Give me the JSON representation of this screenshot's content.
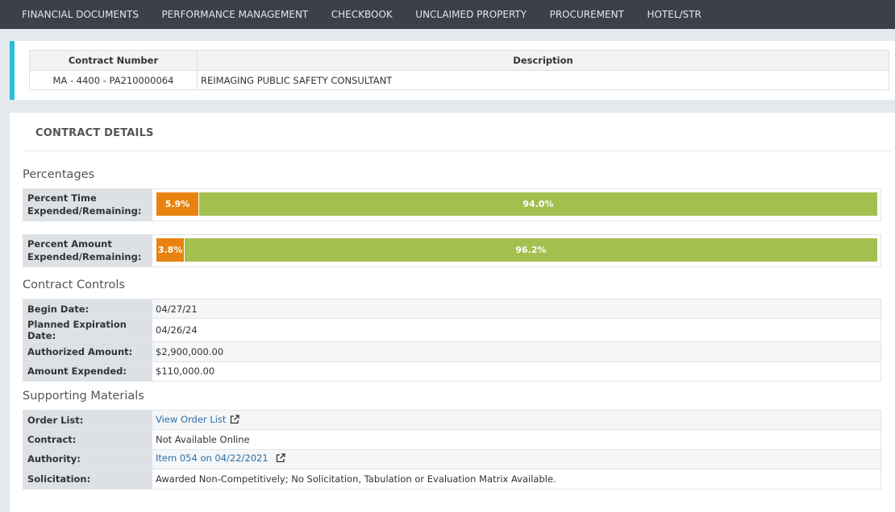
{
  "nav": {
    "items": [
      "FINANCIAL DOCUMENTS",
      "PERFORMANCE MANAGEMENT",
      "CHECKBOOK",
      "UNCLAIMED PROPERTY",
      "PROCUREMENT",
      "HOTEL/STR"
    ]
  },
  "header": {
    "col_contract_number": "Contract Number",
    "col_description": "Description",
    "contract_number": "MA - 4400 - PA210000064",
    "description": "REIMAGING PUBLIC SAFETY CONSULTANT",
    "accent_color": "#29bfd6"
  },
  "details": {
    "title": "CONTRACT DETAILS",
    "percentages": {
      "title": "Percentages",
      "time": {
        "label_line1": "Percent Time",
        "label_line2": "Expended/Remaining:",
        "expended": "5.9%",
        "remaining": "94.0%",
        "expended_fraction": 0.059
      },
      "amount": {
        "label_line1": "Percent Amount",
        "label_line2": "Expended/Remaining:",
        "expended": "3.8%",
        "remaining": "96.2%",
        "expended_fraction": 0.038
      },
      "expended_color": "#e8830f",
      "remaining_color": "#a3bf4d"
    },
    "controls": {
      "title": "Contract Controls",
      "rows": [
        {
          "label": "Begin Date:",
          "value": "04/27/21"
        },
        {
          "label": "Planned Expiration Date:",
          "value": "04/26/24"
        },
        {
          "label": "Authorized Amount:",
          "value": "$2,900,000.00"
        },
        {
          "label": "Amount Expended:",
          "value": "$110,000.00"
        }
      ]
    },
    "supporting": {
      "title": "Supporting Materials",
      "order_list_label": "Order List:",
      "order_list_link": "View Order List",
      "contract_label": "Contract:",
      "contract_value": "Not Available Online",
      "authority_label": "Authority:",
      "authority_link": "Item 054 on 04/22/2021",
      "solicitation_label": "Solicitation:",
      "solicitation_value": "Awarded Non-Competitively; No Solicitation, Tabulation or Evaluation Matrix Available."
    }
  }
}
